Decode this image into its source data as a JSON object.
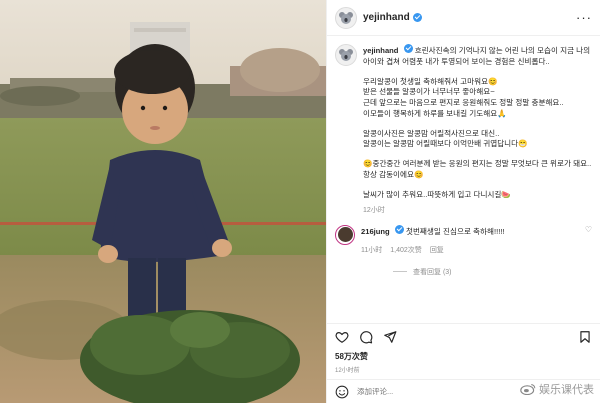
{
  "post": {
    "username": "yejinhand",
    "more_label": "···",
    "caption_paragraphs": [
      "흐린사진속의 기억나지 않는 어린 나의 모습이 지금 나의 아이와 겹쳐 어렴풋 내가 투영되어 보이는 경험은 신비롭다..",
      "우리알콩이 첫생일 축하해줘서 고마워요😊\n받은 선물들 알콩이가 너무너무 좋아해요~\n근데 앞으로는 마음으로 편지로 응원해줘도 정말 정말 충분해요..\n이모들이 행복하게 하루를 보내길 기도해요🙏",
      "알콩이사진은 알콩맘 어릴적사진으로 대신..\n알콩이는 알콩맘 어릴때보다 이억만배 귀엽답니다😁",
      "😊중간중간 여러분께 받는 응원의 편지는 정말 무엇보다 큰 위로가 돼요..항상 감동이에요😊",
      "날씨가 많이 추워요..따뜻하게 입고 다니시길🍉"
    ],
    "time_ago": "12小时"
  },
  "comment": {
    "username": "216jung",
    "text": "첫번째생일 진심으로 축하해!!!!!",
    "time": "11小时",
    "likes": "1,402次赞",
    "reply_label": "回复",
    "view_replies": "查看回复 (3)"
  },
  "stats": {
    "likes": "58万次赞",
    "ago": "12小时前"
  },
  "add_comment": {
    "placeholder": "添加评论..."
  },
  "watermark": {
    "text": "娱乐课代表"
  },
  "colors": {
    "verified": "#3897f0",
    "story_ring": "#c13584"
  }
}
